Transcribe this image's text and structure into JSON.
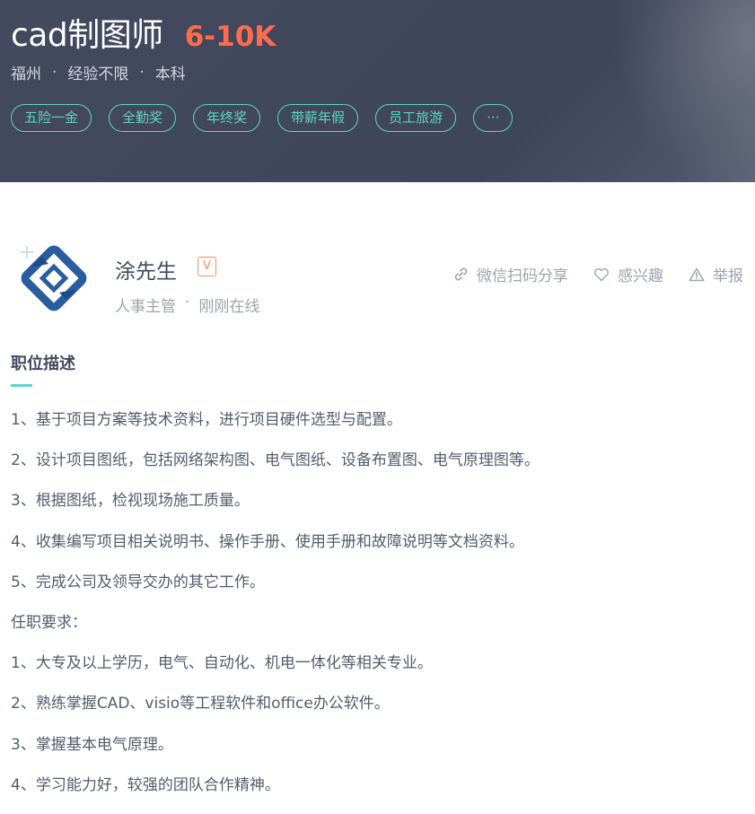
{
  "job": {
    "title": "cad制图师",
    "salary": "6-10K",
    "city": "福州",
    "experience": "经验不限",
    "education": "本科",
    "dot": "·",
    "tags": [
      "五险一金",
      "全勤奖",
      "年终奖",
      "带薪年假",
      "员工旅游",
      "···"
    ]
  },
  "recruiter": {
    "name": "涂先生",
    "badge": "V",
    "role": "人事主管",
    "status": "刚刚在线",
    "dot": "·"
  },
  "actions": {
    "share_label": "微信扫码分享",
    "interest_label": "感兴趣",
    "report_label": "举报"
  },
  "description": {
    "title": "职位描述",
    "lines": [
      "1、基于项目方案等技术资料，进行项目硬件选型与配置。",
      "2、设计项目图纸，包括网络架构图、电气图纸、设备布置图、电气原理图等。",
      "3、根据图纸，检视现场施工质量。",
      "4、收集编写项目相关说明书、操作手册、使用手册和故障说明等文档资料。",
      "5、完成公司及领导交办的其它工作。",
      "任职要求：",
      "1、大专及以上学历，电气、自动化、机电一体化等相关专业。",
      "2、熟练掌握CAD、visio等工程软件和office办公软件。",
      "3、掌握基本电气原理。",
      "4、学习能力好，较强的团队合作精神。"
    ]
  },
  "colors": {
    "header_bg": "#434a5f",
    "salary": "#ff6c4c",
    "accent": "#5dd5c8",
    "badge": "#ff8a5c"
  }
}
